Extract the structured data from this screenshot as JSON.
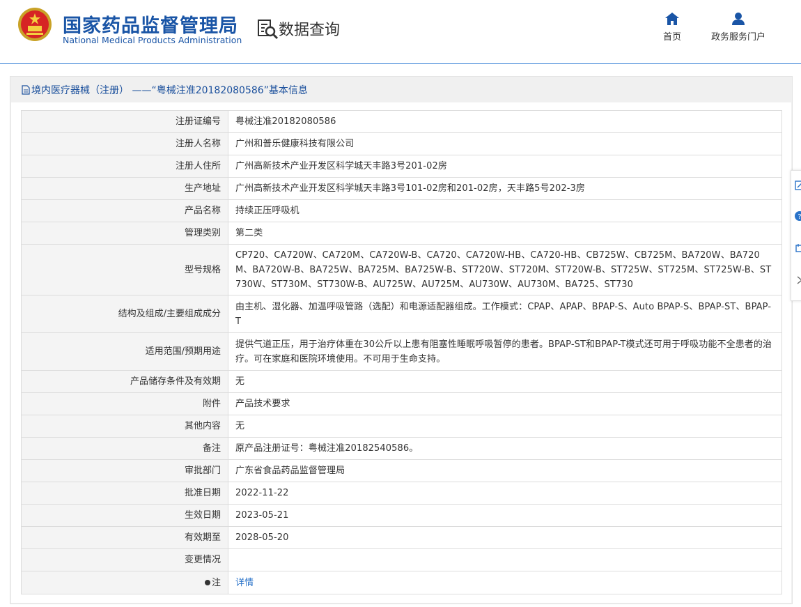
{
  "header": {
    "org_name_cn": "国家药品监督管理局",
    "org_name_en": "National Medical Products Administration",
    "section": "数据查询",
    "nav": [
      {
        "label": "首页",
        "icon": "home-icon"
      },
      {
        "label": "政务服务门户",
        "icon": "user-icon"
      }
    ]
  },
  "panel": {
    "title": "境内医疗器械（注册） ——“粤械注准20182080586”基本信息"
  },
  "rows": [
    {
      "label": "注册证编号",
      "value": "粤械注准20182080586"
    },
    {
      "label": "注册人名称",
      "value": "广州和普乐健康科技有限公司"
    },
    {
      "label": "注册人住所",
      "value": "广州高新技术产业开发区科学城天丰路3号201-02房"
    },
    {
      "label": "生产地址",
      "value": "广州高新技术产业开发区科学城天丰路3号101-02房和201-02房，天丰路5号202-3房"
    },
    {
      "label": "产品名称",
      "value": "持续正压呼吸机"
    },
    {
      "label": "管理类别",
      "value": "第二类"
    },
    {
      "label": "型号规格",
      "value": "CP720、CA720W、CA720M、CA720W-B、CA720、CA720W-HB、CA720-HB、CB725W、CB725M、BA720W、BA720M、BA720W-B、BA725W、BA725M、BA725W-B、ST720W、ST720M、ST720W-B、ST725W、ST725M、ST725W-B、ST730W、ST730M、ST730W-B、AU725W、AU725M、AU730W、AU730M、BA725、ST730"
    },
    {
      "label": "结构及组成/主要组成成分",
      "value": "由主机、湿化器、加温呼吸管路（选配）和电源适配器组成。工作模式：CPAP、APAP、BPAP-S、Auto BPAP-S、BPAP-ST、BPAP-T"
    },
    {
      "label": "适用范围/预期用途",
      "value": "提供气道正压，用于治疗体重在30公斤以上患有阻塞性睡眠呼吸暂停的患者。BPAP-ST和BPAP-T模式还可用于呼吸功能不全患者的治疗。可在家庭和医院环境使用。不可用于生命支持。"
    },
    {
      "label": "产品储存条件及有效期",
      "value": "无"
    },
    {
      "label": "附件",
      "value": "产品技术要求"
    },
    {
      "label": "其他内容",
      "value": "无"
    },
    {
      "label": "备注",
      "value": "原产品注册证号：粤械注准20182540586。"
    },
    {
      "label": "审批部门",
      "value": "广东省食品药品监督管理局"
    },
    {
      "label": "批准日期",
      "value": "2022-11-22"
    },
    {
      "label": "生效日期",
      "value": "2023-05-21"
    },
    {
      "label": "有效期至",
      "value": "2028-05-20"
    },
    {
      "label": "变更情况",
      "value": ""
    },
    {
      "label": "注",
      "value": "详情"
    }
  ],
  "colors": {
    "brand_blue": "#1a55a6",
    "link_blue": "#2a73c9",
    "label_bg": "#f4f4f4"
  }
}
